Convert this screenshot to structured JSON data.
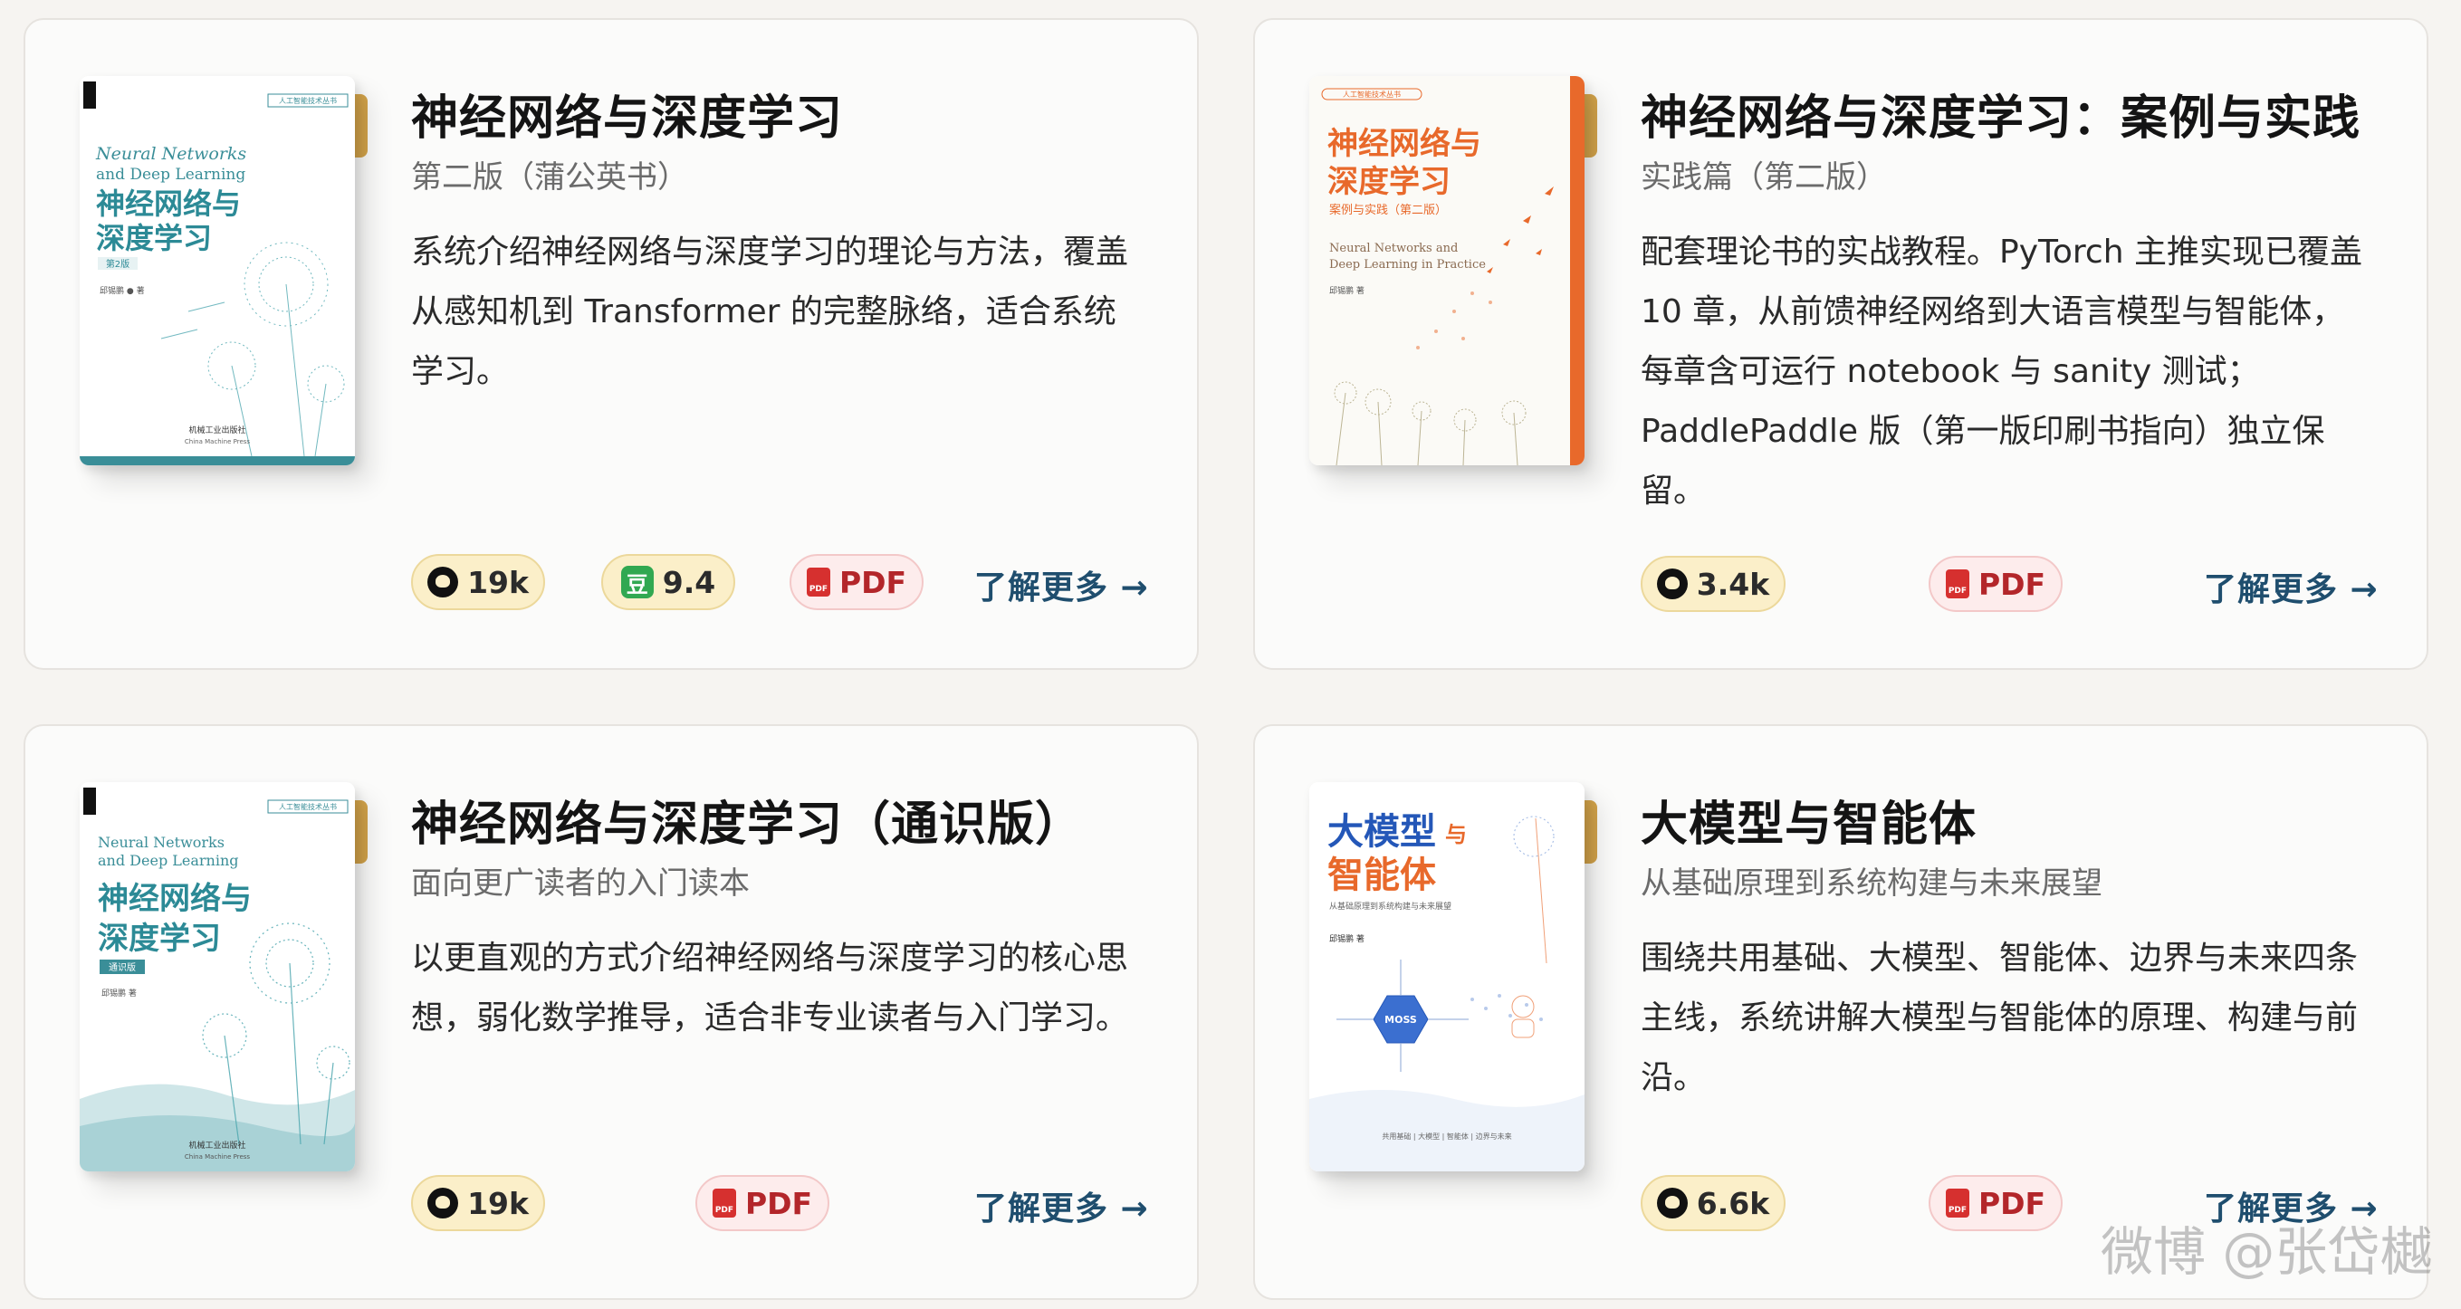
{
  "colors": {
    "accent": "#1f4e6e",
    "star_badge_bg": "#fbefc9",
    "pdf_badge_bg": "#fdecec",
    "pdf_red": "#d6302f",
    "douban_green": "#31a851",
    "card_bg": "#fbfbfa"
  },
  "books": [
    {
      "title": "神经网络与深度学习",
      "subtitle": "第二版（蒲公英书）",
      "desc": "系统介绍神经网络与深度学习的理论与方法，覆盖从感知机到 Transformer 的完整脉络，适合系统学习。",
      "cover": {
        "series": "人工智能技术丛书",
        "en_title_1": "Neural Networks",
        "en_title_2": "and Deep Learning",
        "cn_title_1": "神经网络与",
        "cn_title_2": "深度学习",
        "edition": "第2版",
        "author": "邱锡鹏 ● 著",
        "publisher": "机械工业出版社",
        "publisher_en": "China Machine Press"
      },
      "github": "19k",
      "douban_icon": "豆",
      "douban": "9.4",
      "pdf": "PDF",
      "more": "了解更多 →"
    },
    {
      "title": "神经网络与深度学习：案例与实践",
      "subtitle": "实践篇（第二版）",
      "desc": "配套理论书的实战教程。PyTorch 主推实现已覆盖 10 章，从前馈神经网络到大语言模型与智能体，每章含可运行 notebook 与 sanity 测试；PaddlePaddle 版（第一版印刷书指向）独立保留。",
      "cover": {
        "series": "人工智能技术丛书",
        "cn_title_1": "神经网络与",
        "cn_title_2": "深度学习",
        "cn_sub": "案例与实践（第二版）",
        "en_title_1": "Neural Networks and",
        "en_title_2": "Deep Learning in Practice",
        "author": "邱锡鹏 著"
      },
      "github": "3.4k",
      "pdf": "PDF",
      "more": "了解更多 →"
    },
    {
      "title": "神经网络与深度学习（通识版）",
      "subtitle": "面向更广读者的入门读本",
      "desc": "以更直观的方式介绍神经网络与深度学习的核心思想，弱化数学推导，适合非专业读者与入门学习。",
      "cover": {
        "series": "人工智能技术丛书",
        "en_title_1": "Neural Networks",
        "en_title_2": "and Deep Learning",
        "cn_title_1": "神经网络与",
        "cn_title_2": "深度学习",
        "edition": "通识版",
        "author": "邱锡鹏 著",
        "publisher": "机械工业出版社",
        "publisher_en": "China Machine Press"
      },
      "github": "19k",
      "pdf": "PDF",
      "more": "了解更多 →"
    },
    {
      "title": "大模型与智能体",
      "subtitle": "从基础原理到系统构建与未来展望",
      "desc": "围绕共用基础、大模型、智能体、边界与未来四条主线，系统讲解大模型与智能体的原理、构建与前沿。",
      "cover": {
        "cn_title_1": "大模型",
        "cn_title_small": "与",
        "cn_title_2": "智能体",
        "cn_sub": "从基础原理到系统构建与未来展望",
        "author": "邱锡鹏 著",
        "center": "MOSS",
        "footer": "共用基础  |  大模型  |  智能体  |  边界与未来"
      },
      "github": "6.6k",
      "pdf": "PDF",
      "more": "了解更多 →"
    }
  ],
  "watermark": "微博 @张岱樾"
}
